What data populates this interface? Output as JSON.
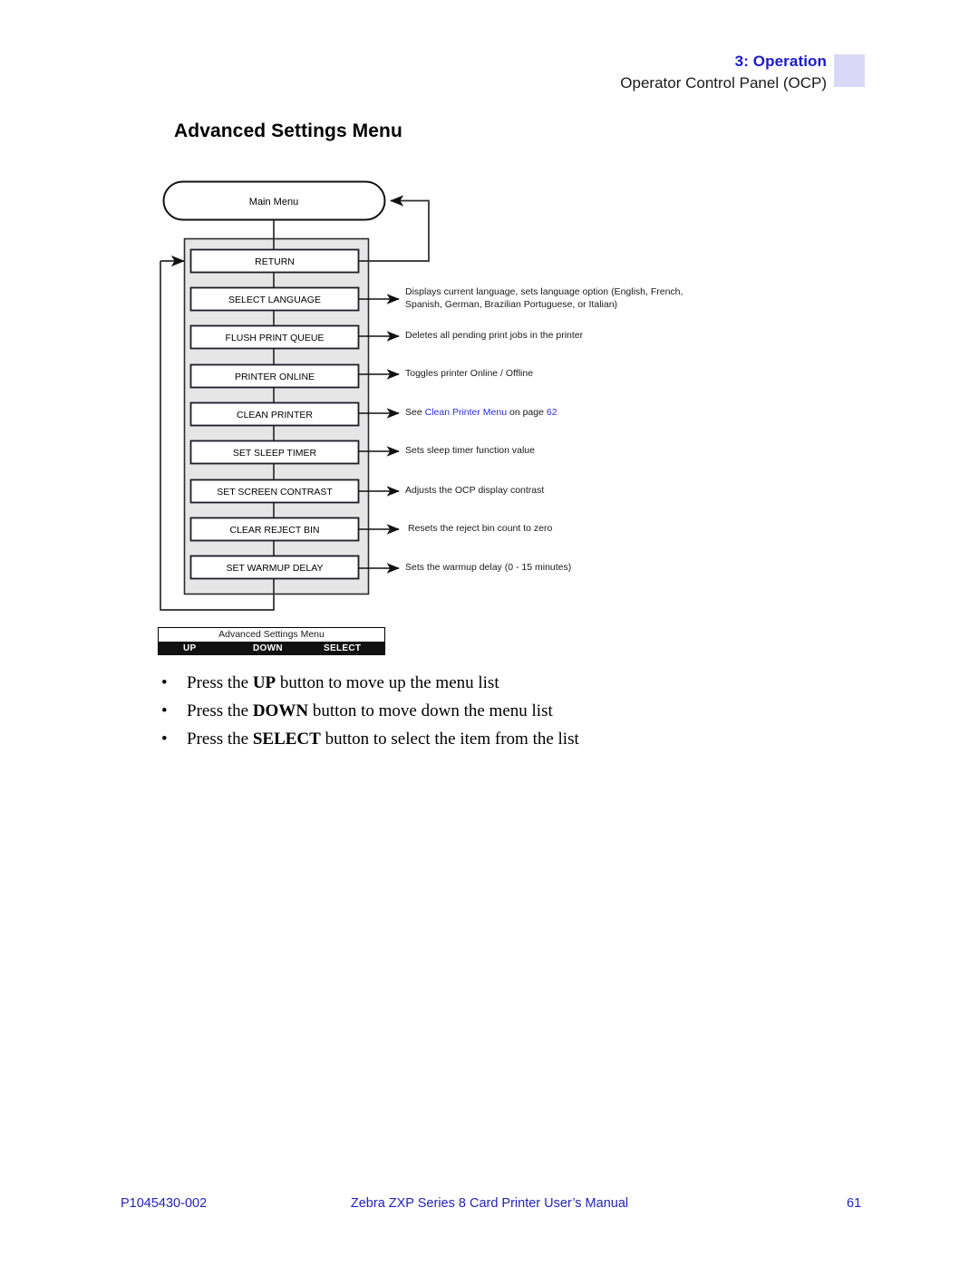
{
  "header": {
    "chapter": "3: Operation",
    "subtitle": "Operator Control Panel (OCP)",
    "accent_color": "#d9d9f7",
    "chapter_color": "#1a1acc"
  },
  "page_title": "Advanced Settings Menu",
  "diagram": {
    "root_node": "Main Menu",
    "menu_items": [
      {
        "label": "RETURN",
        "annotation_lines": []
      },
      {
        "label": "SELECT LANGUAGE",
        "annotation_lines": [
          "Displays current language, sets language option (English, French,",
          "Spanish, German, Brazilian Portuguese, or Italian)"
        ]
      },
      {
        "label": "FLUSH PRINT QUEUE",
        "annotation_lines": [
          "Deletes all pending print jobs in the printer"
        ]
      },
      {
        "label": "PRINTER ONLINE",
        "annotation_lines": [
          "Toggles printer Online / Offline"
        ]
      },
      {
        "label": "CLEAN PRINTER",
        "annotation_lines": [
          "See Clean Printer Menu on page 62"
        ],
        "link_text": "Clean Printer Menu",
        "link_prefix": "See ",
        "link_suffix": " on page ",
        "link_page": "62"
      },
      {
        "label": "SET SLEEP TIMER",
        "annotation_lines": [
          "Sets sleep timer function value"
        ]
      },
      {
        "label": "SET SCREEN CONTRAST",
        "annotation_lines": [
          "Adjusts the OCP display contrast"
        ]
      },
      {
        "label": "CLEAR REJECT BIN",
        "annotation_lines": [
          "Resets the reject bin count to zero"
        ]
      },
      {
        "label": "SET WARMUP DELAY",
        "annotation_lines": [
          "Sets the warmup delay (0 - 15 minutes)"
        ]
      }
    ],
    "panel_fill": "#e6e6e6",
    "link_color": "#2b2be0"
  },
  "ocp": {
    "display_text": "Advanced Settings Menu",
    "buttons": [
      "UP",
      "DOWN",
      "SELECT"
    ],
    "bar_color": "#111111"
  },
  "instructions": [
    {
      "prefix": "Press the ",
      "key": "UP",
      "suffix": " button to move up the menu list"
    },
    {
      "prefix": "Press the ",
      "key": "DOWN",
      "suffix": " button to move down the menu list"
    },
    {
      "prefix": "Press the ",
      "key": "SELECT",
      "suffix": " button to select the item from the list"
    }
  ],
  "footer": {
    "doc_number": "P1045430-002",
    "manual_title": "Zebra ZXP Series 8 Card Printer User’s Manual",
    "page_number": "61",
    "color": "#2222bb"
  }
}
